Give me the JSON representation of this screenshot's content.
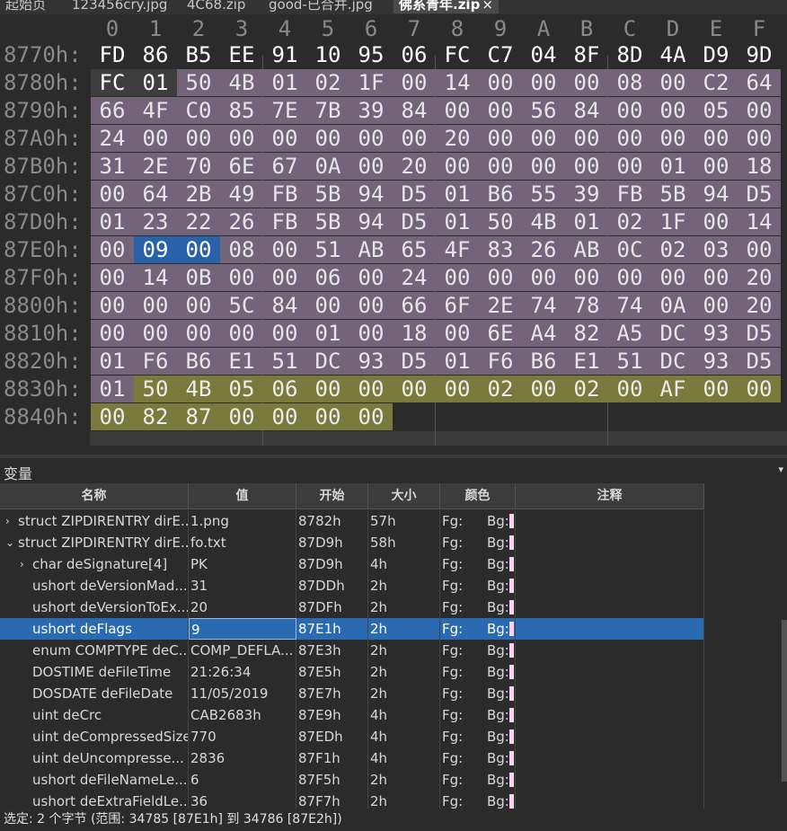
{
  "tabs": [
    "起始页",
    "123456cry.jpg",
    "4C68.zip",
    "good-已合并.jpg",
    "佛系青年.zip"
  ],
  "active_tab": "佛系青年.zip",
  "close_glyph": "×",
  "hex_columns": [
    "0",
    "1",
    "2",
    "3",
    "4",
    "5",
    "6",
    "7",
    "8",
    "9",
    "A",
    "B",
    "C",
    "D",
    "E",
    "F"
  ],
  "hex_rows": [
    {
      "addr": "8770h:",
      "bytes": [
        "FD",
        "86",
        "B5",
        "EE",
        "91",
        "10",
        "95",
        "06",
        "FC",
        "C7",
        "04",
        "8F",
        "8D",
        "4A",
        "D9",
        "9D"
      ]
    },
    {
      "addr": "8780h:",
      "bytes": [
        "FC",
        "01",
        "50",
        "4B",
        "01",
        "02",
        "1F",
        "00",
        "14",
        "00",
        "00",
        "00",
        "08",
        "00",
        "C2",
        "64"
      ]
    },
    {
      "addr": "8790h:",
      "bytes": [
        "66",
        "4F",
        "C0",
        "85",
        "7E",
        "7B",
        "39",
        "84",
        "00",
        "00",
        "56",
        "84",
        "00",
        "00",
        "05",
        "00"
      ]
    },
    {
      "addr": "87A0h:",
      "bytes": [
        "24",
        "00",
        "00",
        "00",
        "00",
        "00",
        "00",
        "00",
        "20",
        "00",
        "00",
        "00",
        "00",
        "00",
        "00",
        "00"
      ]
    },
    {
      "addr": "87B0h:",
      "bytes": [
        "31",
        "2E",
        "70",
        "6E",
        "67",
        "0A",
        "00",
        "20",
        "00",
        "00",
        "00",
        "00",
        "00",
        "01",
        "00",
        "18"
      ]
    },
    {
      "addr": "87C0h:",
      "bytes": [
        "00",
        "64",
        "2B",
        "49",
        "FB",
        "5B",
        "94",
        "D5",
        "01",
        "B6",
        "55",
        "39",
        "FB",
        "5B",
        "94",
        "D5"
      ]
    },
    {
      "addr": "87D0h:",
      "bytes": [
        "01",
        "23",
        "22",
        "26",
        "FB",
        "5B",
        "94",
        "D5",
        "01",
        "50",
        "4B",
        "01",
        "02",
        "1F",
        "00",
        "14"
      ]
    },
    {
      "addr": "87E0h:",
      "bytes": [
        "00",
        "09",
        "00",
        "08",
        "00",
        "51",
        "AB",
        "65",
        "4F",
        "83",
        "26",
        "AB",
        "0C",
        "02",
        "03",
        "00"
      ]
    },
    {
      "addr": "87F0h:",
      "bytes": [
        "00",
        "14",
        "0B",
        "00",
        "00",
        "06",
        "00",
        "24",
        "00",
        "00",
        "00",
        "00",
        "00",
        "00",
        "00",
        "20"
      ]
    },
    {
      "addr": "8800h:",
      "bytes": [
        "00",
        "00",
        "00",
        "5C",
        "84",
        "00",
        "00",
        "66",
        "6F",
        "2E",
        "74",
        "78",
        "74",
        "0A",
        "00",
        "20"
      ]
    },
    {
      "addr": "8810h:",
      "bytes": [
        "00",
        "00",
        "00",
        "00",
        "00",
        "01",
        "00",
        "18",
        "00",
        "6E",
        "A4",
        "82",
        "A5",
        "DC",
        "93",
        "D5"
      ]
    },
    {
      "addr": "8820h:",
      "bytes": [
        "01",
        "F6",
        "B6",
        "E1",
        "51",
        "DC",
        "93",
        "D5",
        "01",
        "F6",
        "B6",
        "E1",
        "51",
        "DC",
        "93",
        "D5"
      ]
    },
    {
      "addr": "8830h:",
      "bytes": [
        "01",
        "50",
        "4B",
        "05",
        "06",
        "00",
        "00",
        "00",
        "00",
        "02",
        "00",
        "02",
        "00",
        "AF",
        "00",
        "00"
      ]
    },
    {
      "addr": "8840h:",
      "bytes": [
        "00",
        "82",
        "87",
        "00",
        "00",
        "00",
        "00"
      ]
    }
  ],
  "colors": {
    "dir_entry": "#74647a",
    "end_record": "#7a7a3c",
    "selection": "#2962a8",
    "row_selected": "#2a6ab0"
  },
  "panel_title": "变量",
  "panel_dropdown_glyph": "▾",
  "table_headers": [
    "名称",
    "值",
    "开始",
    "大小",
    "颜色",
    "注释"
  ],
  "variables": [
    {
      "indent": 0,
      "expander": "›",
      "name": "struct ZIPDIRENTRY dirE...",
      "value": "1.png",
      "start": "8782h",
      "size": "57h",
      "fg": "Fg:",
      "bg": "Bg:"
    },
    {
      "indent": 0,
      "expander": "⌄",
      "name": "struct ZIPDIRENTRY dirE...",
      "value": "fo.txt",
      "start": "87D9h",
      "size": "58h",
      "fg": "Fg:",
      "bg": "Bg:"
    },
    {
      "indent": 1,
      "expander": "›",
      "name": "char deSignature[4]",
      "value": "PK\u0001",
      "start": "87D9h",
      "size": "4h",
      "fg": "Fg:",
      "bg": "Bg:"
    },
    {
      "indent": 1,
      "expander": "",
      "name": "ushort deVersionMad...",
      "value": "31",
      "start": "87DDh",
      "size": "2h",
      "fg": "Fg:",
      "bg": "Bg:"
    },
    {
      "indent": 1,
      "expander": "",
      "name": "ushort deVersionToEx...",
      "value": "20",
      "start": "87DFh",
      "size": "2h",
      "fg": "Fg:",
      "bg": "Bg:"
    },
    {
      "indent": 1,
      "expander": "",
      "name": "ushort deFlags",
      "value": "9",
      "start": "87E1h",
      "size": "2h",
      "fg": "Fg:",
      "bg": "Bg:",
      "selected": true
    },
    {
      "indent": 1,
      "expander": "",
      "name": "enum COMPTYPE deC...",
      "value": "COMP_DEFLA...",
      "start": "87E3h",
      "size": "2h",
      "fg": "Fg:",
      "bg": "Bg:"
    },
    {
      "indent": 1,
      "expander": "",
      "name": "DOSTIME deFileTime",
      "value": "21:26:34",
      "start": "87E5h",
      "size": "2h",
      "fg": "Fg:",
      "bg": "Bg:"
    },
    {
      "indent": 1,
      "expander": "",
      "name": "DOSDATE deFileDate",
      "value": "11/05/2019",
      "start": "87E7h",
      "size": "2h",
      "fg": "Fg:",
      "bg": "Bg:"
    },
    {
      "indent": 1,
      "expander": "",
      "name": "uint deCrc",
      "value": "CAB2683h",
      "start": "87E9h",
      "size": "4h",
      "fg": "Fg:",
      "bg": "Bg:"
    },
    {
      "indent": 1,
      "expander": "",
      "name": "uint deCompressedSize",
      "value": "770",
      "start": "87EDh",
      "size": "4h",
      "fg": "Fg:",
      "bg": "Bg:"
    },
    {
      "indent": 1,
      "expander": "",
      "name": "uint deUncompresse...",
      "value": "2836",
      "start": "87F1h",
      "size": "4h",
      "fg": "Fg:",
      "bg": "Bg:"
    },
    {
      "indent": 1,
      "expander": "",
      "name": "ushort deFileNameLe...",
      "value": "6",
      "start": "87F5h",
      "size": "2h",
      "fg": "Fg:",
      "bg": "Bg:"
    },
    {
      "indent": 1,
      "expander": "",
      "name": "ushort deExtraFieldLe...",
      "value": "36",
      "start": "87F7h",
      "size": "2h",
      "fg": "Fg:",
      "bg": "Bg:"
    }
  ],
  "status": "选定: 2 个字节 (范围: 34785 [87E1h] 到 34786 [87E2h])"
}
